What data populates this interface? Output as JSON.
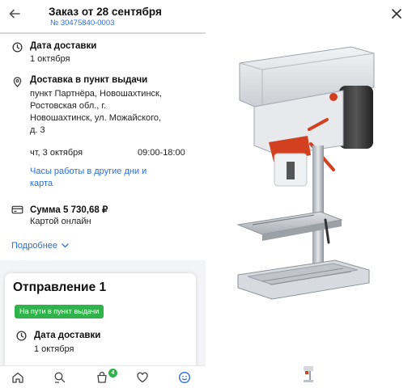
{
  "header": {
    "title": "Заказ от 28 сентября",
    "order_number": "№ 30475840-0003"
  },
  "delivery_date": {
    "label": "Дата доставки",
    "value": "1 октября"
  },
  "pickup": {
    "label": "Доставка в пункт выдачи",
    "address_lines": [
      "пункт Партнёра, Новошахтинск,",
      "Ростовская обл., г.",
      "Новошахтинск, ул. Можайского,",
      "д. 3"
    ],
    "day": "чт, 3 октября",
    "hours": "09:00-18:00",
    "other_days_link_lines": [
      "Часы работы в другие дни и",
      "карта"
    ]
  },
  "payment": {
    "label": "Сумма 5 730,68 ₽",
    "method": "Картой онлайн"
  },
  "more_link": "Подробнее",
  "shipment": {
    "title": "Отправление 1",
    "status_badge": "На пути в пункт выдачи",
    "delivery_label": "Дата доставки",
    "delivery_value": "1 октября"
  },
  "bottom_nav": {
    "cart_count": "4"
  },
  "colors": {
    "accent": "#2a6fd6",
    "success": "#2fb34a"
  }
}
